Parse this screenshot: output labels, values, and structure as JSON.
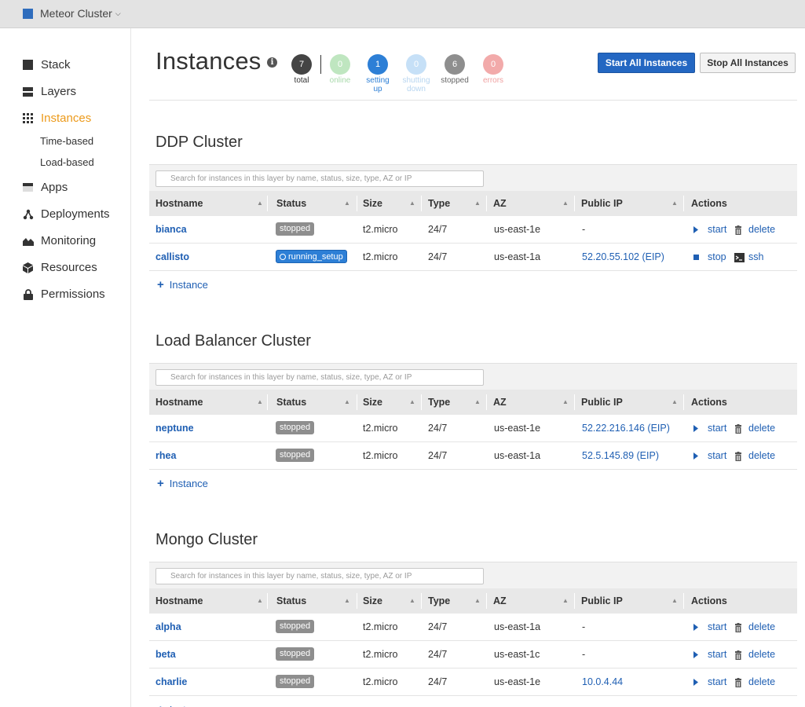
{
  "stack": {
    "name": "Meteor Cluster"
  },
  "nav": {
    "items": [
      {
        "label": "Stack",
        "icon": "stack-icon"
      },
      {
        "label": "Layers",
        "icon": "layers-icon"
      },
      {
        "label": "Instances",
        "icon": "instances-grid-icon",
        "active": true
      },
      {
        "label": "Apps",
        "icon": "apps-icon"
      },
      {
        "label": "Deployments",
        "icon": "deployments-icon"
      },
      {
        "label": "Monitoring",
        "icon": "monitoring-icon"
      },
      {
        "label": "Resources",
        "icon": "resources-icon"
      },
      {
        "label": "Permissions",
        "icon": "lock-icon"
      }
    ],
    "sub": [
      "Time-based",
      "Load-based"
    ]
  },
  "page": {
    "title": "Instances",
    "counters": [
      {
        "value": "7",
        "label": "total",
        "color": "#444444",
        "text": "#333333"
      },
      {
        "value": "0",
        "label": "online",
        "color": "#bfe6c0",
        "text": "#a8d9aa"
      },
      {
        "value": "1",
        "label": "setting up",
        "color": "#2d7fd6",
        "text": "#2d7fd6"
      },
      {
        "value": "0",
        "label": "shutting down",
        "color": "#c6e0f7",
        "text": "#b7d5f0"
      },
      {
        "value": "6",
        "label": "stopped",
        "color": "#8e8e8e",
        "text": "#666666"
      },
      {
        "value": "0",
        "label": "errors",
        "color": "#f2aaaa",
        "text": "#efa0a0"
      }
    ],
    "start_all": "Start All Instances",
    "stop_all": "Stop All Instances"
  },
  "table_headers": [
    "Hostname",
    "Status",
    "Size",
    "Type",
    "AZ",
    "Public IP",
    "Actions"
  ],
  "search_placeholder": "Search for instances in this layer by name, status, size, type, AZ or IP",
  "add_instance_label": "Instance",
  "layers": [
    {
      "title": "DDP Cluster",
      "rows": [
        {
          "hostname": "bianca",
          "status": "stopped",
          "size": "t2.micro",
          "type": "24/7",
          "az": "us-east-1e",
          "ip": "-",
          "action1": "start",
          "action2": "delete"
        },
        {
          "hostname": "callisto",
          "status": "running_setup",
          "size": "t2.micro",
          "type": "24/7",
          "az": "us-east-1a",
          "ip": "52.20.55.102 (EIP)",
          "action1": "stop",
          "action2": "ssh"
        }
      ]
    },
    {
      "title": "Load Balancer Cluster",
      "rows": [
        {
          "hostname": "neptune",
          "status": "stopped",
          "size": "t2.micro",
          "type": "24/7",
          "az": "us-east-1e",
          "ip": "52.22.216.146 (EIP)",
          "action1": "start",
          "action2": "delete"
        },
        {
          "hostname": "rhea",
          "status": "stopped",
          "size": "t2.micro",
          "type": "24/7",
          "az": "us-east-1a",
          "ip": "52.5.145.89 (EIP)",
          "action1": "start",
          "action2": "delete"
        }
      ]
    },
    {
      "title": "Mongo Cluster",
      "rows": [
        {
          "hostname": "alpha",
          "status": "stopped",
          "size": "t2.micro",
          "type": "24/7",
          "az": "us-east-1a",
          "ip": "-",
          "action1": "start",
          "action2": "delete"
        },
        {
          "hostname": "beta",
          "status": "stopped",
          "size": "t2.micro",
          "type": "24/7",
          "az": "us-east-1c",
          "ip": "-",
          "action1": "start",
          "action2": "delete"
        },
        {
          "hostname": "charlie",
          "status": "stopped",
          "size": "t2.micro",
          "type": "24/7",
          "az": "us-east-1e",
          "ip": "10.0.4.44",
          "action1": "start",
          "action2": "delete"
        }
      ]
    }
  ]
}
